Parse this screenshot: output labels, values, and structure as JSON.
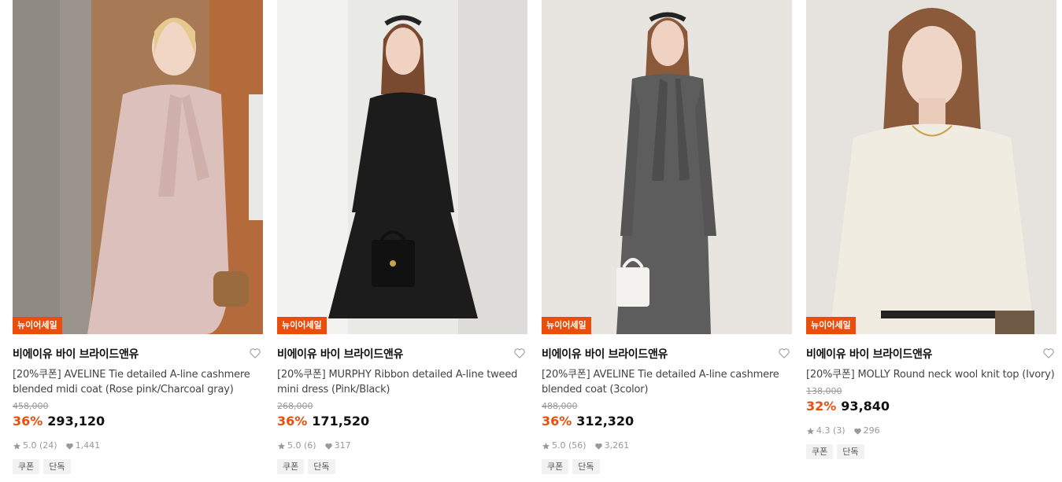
{
  "products": [
    {
      "badge": "뉴이어세일",
      "brand": "비에이유 바이 브라이드앤유",
      "title": "[20%쿠폰] AVELINE Tie detailed A-line cashmere blended midi coat (Rose pink/Charcoal gray)",
      "original_price": "458,000",
      "discount": "36%",
      "price": "293,120",
      "rating": "5.0",
      "reviews": "(24)",
      "likes": "1,441",
      "tags": [
        "쿠폰",
        "단독"
      ],
      "image_desc_colors": {
        "bg": "#b9a38f",
        "garment": "#dcc0bb"
      }
    },
    {
      "badge": "뉴이어세일",
      "brand": "비에이유 바이 브라이드앤유",
      "title": "[20%쿠폰] MURPHY Ribbon detailed A-line tweed mini dress (Pink/Black)",
      "original_price": "268,000",
      "discount": "36%",
      "price": "171,520",
      "rating": "5.0",
      "reviews": "(6)",
      "likes": "317",
      "tags": [
        "쿠폰",
        "단독"
      ],
      "image_desc_colors": {
        "bg": "#ececea",
        "garment": "#1c1c1c"
      }
    },
    {
      "badge": "뉴이어세일",
      "brand": "비에이유 바이 브라이드앤유",
      "title": "[20%쿠폰] AVELINE Tie detailed A-line cashmere blended coat (3color)",
      "original_price": "488,000",
      "discount": "36%",
      "price": "312,320",
      "rating": "5.0",
      "reviews": "(56)",
      "likes": "3,261",
      "tags": [
        "쿠폰",
        "단독"
      ],
      "image_desc_colors": {
        "bg": "#e7e4df",
        "garment": "#5d5d5d"
      }
    },
    {
      "badge": "뉴이어세일",
      "brand": "비에이유 바이 브라이드앤유",
      "title": "[20%쿠폰] MOLLY Round neck wool knit top (Ivory)",
      "original_price": "138,000",
      "discount": "32%",
      "price": "93,840",
      "rating": "4.3",
      "reviews": "(3)",
      "likes": "296",
      "tags": [
        "쿠폰",
        "단독"
      ],
      "image_desc_colors": {
        "bg": "#e6e3df",
        "garment": "#f1ece2"
      }
    }
  ],
  "colors": {
    "accent": "#ea4e0d",
    "text": "#111111",
    "muted": "#999999"
  },
  "icons": {
    "wishlist": "heart-outline-icon",
    "rating": "star-icon",
    "likes": "heart-filled-icon"
  }
}
